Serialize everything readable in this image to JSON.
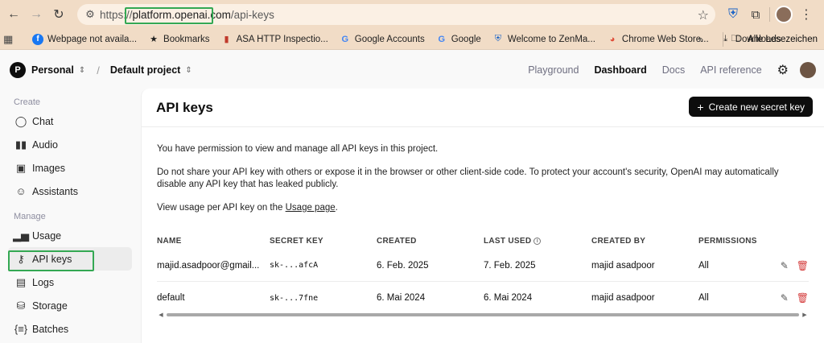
{
  "browser": {
    "url_scheme": "https://",
    "url_host": "platform.openai.com",
    "url_path": "/api-keys",
    "bookmarks": [
      {
        "label": "Webpage not availa...",
        "icon": "facebook-icon"
      },
      {
        "label": "Bookmarks",
        "icon": "star-icon"
      },
      {
        "label": "ASA HTTP Inspectio...",
        "icon": "bookmark-icon"
      },
      {
        "label": "Google Accounts",
        "icon": "google-icon"
      },
      {
        "label": "Google",
        "icon": "google-icon"
      },
      {
        "label": "Welcome to ZenMa...",
        "icon": "shield-icon"
      },
      {
        "label": "Chrome Web Store...",
        "icon": "chrome-store-icon"
      },
      {
        "label": "Downloads",
        "icon": "download-icon"
      }
    ],
    "bookmarks_folder": "Alle Lesezeichen",
    "more_bookmarks": "»"
  },
  "header": {
    "org_initial": "P",
    "org_name": "Personal",
    "crumb_sep": "/",
    "project_name": "Default project",
    "nav": [
      "Playground",
      "Dashboard",
      "Docs",
      "API reference"
    ],
    "active_nav": "Dashboard"
  },
  "sidebar": {
    "sections": [
      {
        "label": "Create",
        "items": [
          {
            "label": "Chat",
            "icon": "chat-icon"
          },
          {
            "label": "Audio",
            "icon": "audio-icon"
          },
          {
            "label": "Images",
            "icon": "image-icon"
          },
          {
            "label": "Assistants",
            "icon": "assistant-icon"
          }
        ]
      },
      {
        "label": "Manage",
        "items": [
          {
            "label": "Usage",
            "icon": "chart-icon"
          },
          {
            "label": "API keys",
            "icon": "key-icon",
            "active": true
          },
          {
            "label": "Logs",
            "icon": "logs-icon"
          },
          {
            "label": "Storage",
            "icon": "storage-icon"
          },
          {
            "label": "Batches",
            "icon": "batches-icon"
          }
        ]
      }
    ]
  },
  "main": {
    "title": "API keys",
    "create_button": "Create new secret key",
    "p1": "You have permission to view and manage all API keys in this project.",
    "p2": "Do not share your API key with others or expose it in the browser or other client-side code. To protect your account's security, OpenAI may automatically disable any API key that has leaked publicly.",
    "p3_prefix": "View usage per API key on the ",
    "p3_link": "Usage page",
    "p3_suffix": ".",
    "columns": [
      "NAME",
      "SECRET KEY",
      "CREATED",
      "LAST USED",
      "CREATED BY",
      "PERMISSIONS"
    ],
    "rows": [
      {
        "name": "majid.asadpoor@gmail...",
        "secret": "sk-...afcA",
        "created": "6. Feb. 2025",
        "last_used": "7. Feb. 2025",
        "created_by": "majid asadpoor",
        "permissions": "All"
      },
      {
        "name": "default",
        "secret": "sk-...7fne",
        "created": "6. Mai 2024",
        "last_used": "6. Mai 2024",
        "created_by": "majid asadpoor",
        "permissions": "All"
      }
    ]
  }
}
